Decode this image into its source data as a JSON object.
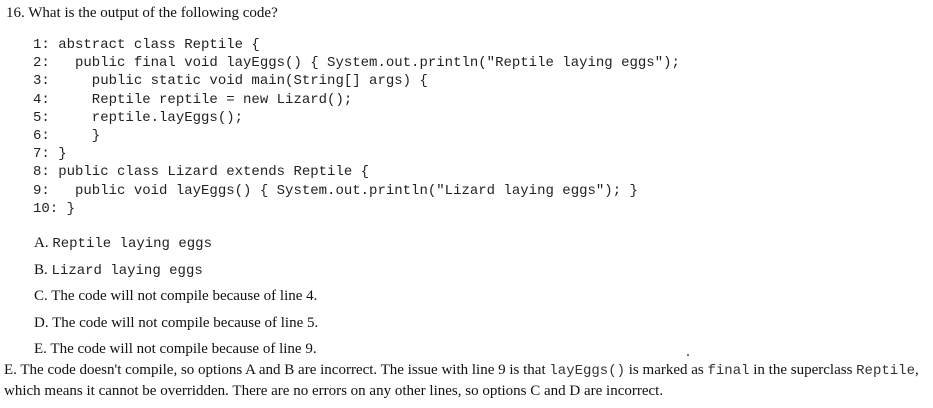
{
  "question": {
    "text": "16. What is the output of the following code?"
  },
  "code_lines": [
    "1: abstract class Reptile {",
    "2:   public final void layEggs() { System.out.println(\"Reptile laying eggs\");",
    "3:     public static void main(String[] args) {",
    "4:     Reptile reptile = new Lizard();",
    "5:     reptile.layEggs();",
    "6:     }",
    "7: }",
    "8: public class Lizard extends Reptile {",
    "9:   public void layEggs() { System.out.println(\"Lizard laying eggs\"); }",
    "10: }"
  ],
  "options": {
    "a": {
      "letter": "A.",
      "text": "Reptile laying eggs"
    },
    "b": {
      "letter": "B.",
      "text": "Lizard laying eggs"
    },
    "c": {
      "letter": "C.",
      "text": "The code will not compile because of line 4."
    },
    "d": {
      "letter": "D.",
      "text": "The code will not compile because of line 5."
    },
    "e": {
      "letter": "E.",
      "text": "The code will not compile because of line 9."
    }
  },
  "answer": {
    "part1": "E. The code doesn't compile, so options A and B are incorrect. The issue with line 9 is that ",
    "code1": "layEggs()",
    "part2": " is marked as ",
    "code2": "final",
    "part3": " in the superclass ",
    "code3": "Reptile",
    "part4": ", which means it cannot be overridden. There are no errors on any other lines, so options C and D are incorrect."
  }
}
